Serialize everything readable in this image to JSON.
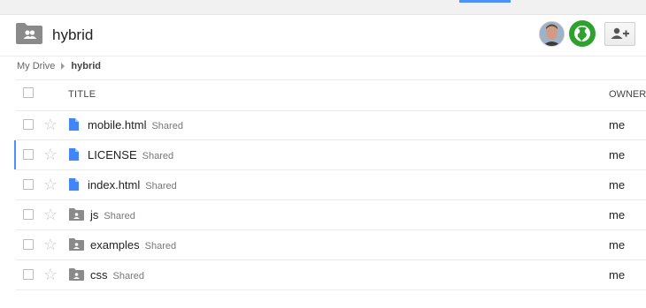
{
  "header": {
    "folder_title": "hybrid"
  },
  "breadcrumb": {
    "root": "My Drive",
    "current": "hybrid"
  },
  "columns": {
    "title": "TITLE",
    "owner": "OWNER"
  },
  "shared_label": "Shared",
  "colors": {
    "accent": "#4d90fe",
    "doc_icon": "#4285f4",
    "folder_icon": "#8a8a8a",
    "public_globe": "#2ea12e"
  },
  "files": [
    {
      "name": "mobile.html",
      "type": "doc",
      "shared": "Shared",
      "owner": "me"
    },
    {
      "name": "LICENSE",
      "type": "doc",
      "shared": "Shared",
      "owner": "me"
    },
    {
      "name": "index.html",
      "type": "doc",
      "shared": "Shared",
      "owner": "me"
    },
    {
      "name": "js",
      "type": "shared-folder",
      "shared": "Shared",
      "owner": "me"
    },
    {
      "name": "examples",
      "type": "shared-folder",
      "shared": "Shared",
      "owner": "me"
    },
    {
      "name": "css",
      "type": "shared-folder",
      "shared": "Shared",
      "owner": "me"
    }
  ]
}
